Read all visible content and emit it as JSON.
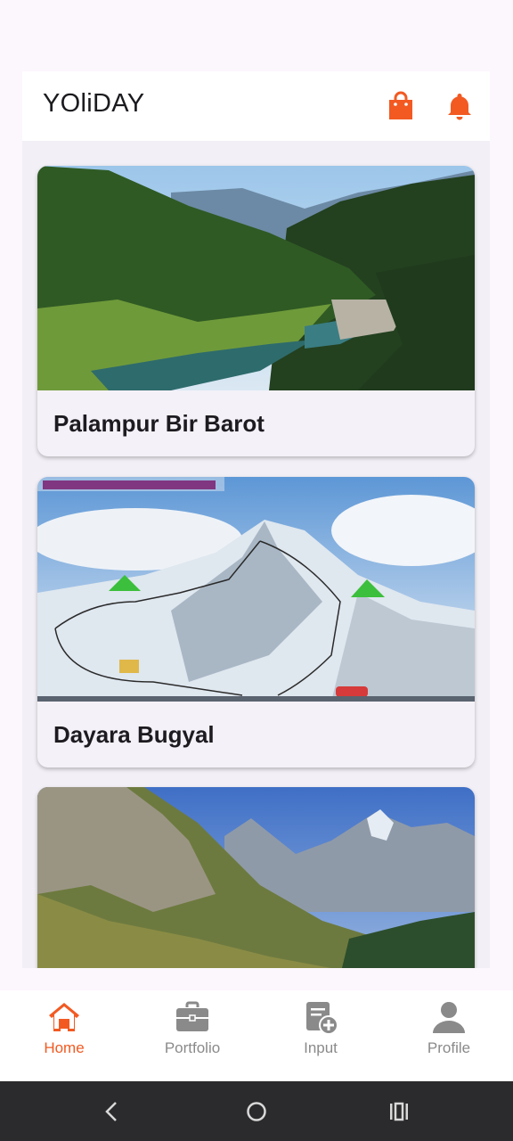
{
  "app": {
    "title": "YOliDAY"
  },
  "header_icons": {
    "cart": "shopping-bag-icon",
    "notifications": "bell-icon"
  },
  "trips": [
    {
      "title": "Palampur Bir Barot",
      "image": "mountain-valley-lake-photo"
    },
    {
      "title": "Dayara Bugyal",
      "image": "dayara-bugyal-trek-map-photo"
    },
    {
      "title": "",
      "image": "rocky-mountain-campsite-photo"
    }
  ],
  "bottom_nav": [
    {
      "label": "Home",
      "icon": "home-icon",
      "active": true
    },
    {
      "label": "Portfolio",
      "icon": "briefcase-icon",
      "active": false
    },
    {
      "label": "Input",
      "icon": "add-document-icon",
      "active": false
    },
    {
      "label": "Profile",
      "icon": "person-icon",
      "active": false
    }
  ],
  "colors": {
    "accent": "#f25a22",
    "inactive": "#8a8a8a",
    "background": "#fcf6fd"
  }
}
